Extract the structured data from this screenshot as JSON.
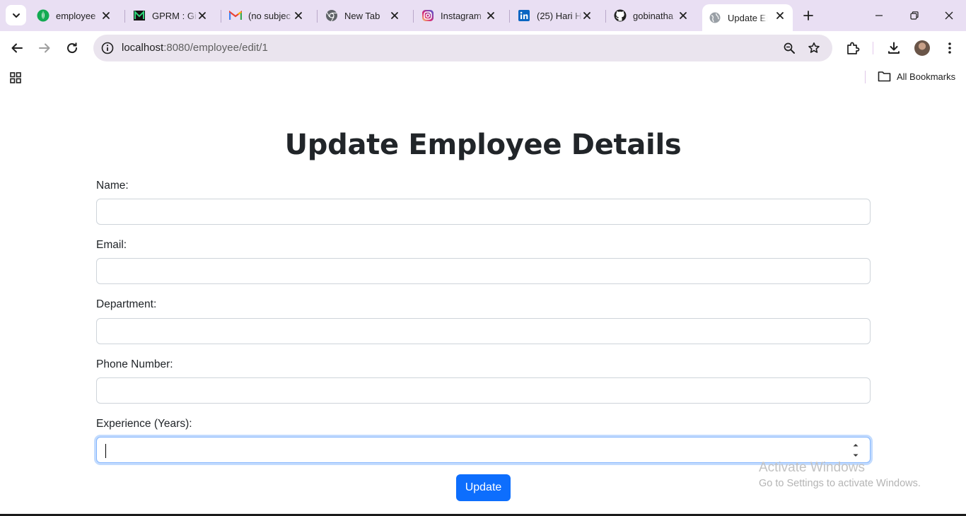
{
  "browser": {
    "tabs": [
      {
        "title": "employee",
        "icon": "mongodb-leaf-icon",
        "close": "close-icon"
      },
      {
        "title": "GPRM : Gi",
        "icon": "gprm-logo-icon",
        "close": "close-icon"
      },
      {
        "title": "(no subjec",
        "icon": "gmail-icon",
        "close": "close-icon"
      },
      {
        "title": "New Tab",
        "icon": "chrome-icon",
        "close": "close-icon"
      },
      {
        "title": "Instagram",
        "icon": "instagram-icon",
        "close": "close-icon"
      },
      {
        "title": "(25) Hari H",
        "icon": "linkedin-icon",
        "close": "close-icon"
      },
      {
        "title": "gobinatha",
        "icon": "github-icon",
        "close": "close-icon"
      },
      {
        "title": "Update Em",
        "icon": "globe-icon",
        "close": "close-icon",
        "active": true
      }
    ],
    "url_host": "localhost",
    "url_path": ":8080/employee/edit/1",
    "bookmarks_label": "All Bookmarks",
    "colors": {
      "tabstrip": "#e9dff3",
      "omnibox": "#eae4ee"
    }
  },
  "page": {
    "title": "Update Employee Details",
    "fields": [
      {
        "label": "Name:",
        "value": ""
      },
      {
        "label": "Email:",
        "value": ""
      },
      {
        "label": "Department:",
        "value": ""
      },
      {
        "label": "Phone Number:",
        "value": ""
      },
      {
        "label": "Experience (Years):",
        "value": ""
      }
    ],
    "submit_label": "Update",
    "colors": {
      "primary": "#0d6efd",
      "focus_ring": "#86b7fe"
    }
  },
  "watermark": {
    "line1": "Activate Windows",
    "line2": "Go to Settings to activate Windows."
  }
}
